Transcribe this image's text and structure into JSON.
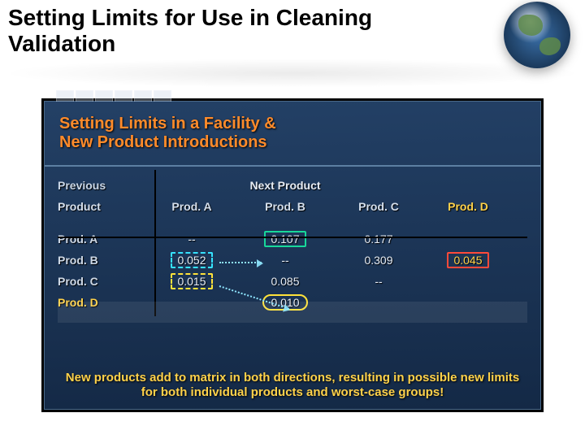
{
  "header": {
    "title": "Setting Limits for Use in Cleaning Validation"
  },
  "panel": {
    "title_line1": "Setting Limits in a Facility &",
    "title_line2": "New Product Introductions",
    "columns": {
      "previous_label_l1": "Previous",
      "previous_label_l2": "Product",
      "next_label": "Next Product",
      "a": "Prod. A",
      "b": "Prod. B",
      "c": "Prod. C",
      "d": "Prod. D"
    },
    "rows": [
      {
        "label": "Prod. A",
        "a": "--",
        "b": "0.107",
        "c": "0.177",
        "d": ""
      },
      {
        "label": "Prod. B",
        "a": "0.052",
        "b": "--",
        "c": "0.309",
        "d": "0.045"
      },
      {
        "label": "Prod. C",
        "a": "0.015",
        "b": "0.085",
        "c": "--",
        "d": ""
      },
      {
        "label": "Prod. D",
        "a": "",
        "b": "0.010",
        "c": "",
        "d": ""
      }
    ],
    "footnote": "New products add to matrix in both directions, resulting in possible new limits for both individual products and worst-case groups!"
  }
}
